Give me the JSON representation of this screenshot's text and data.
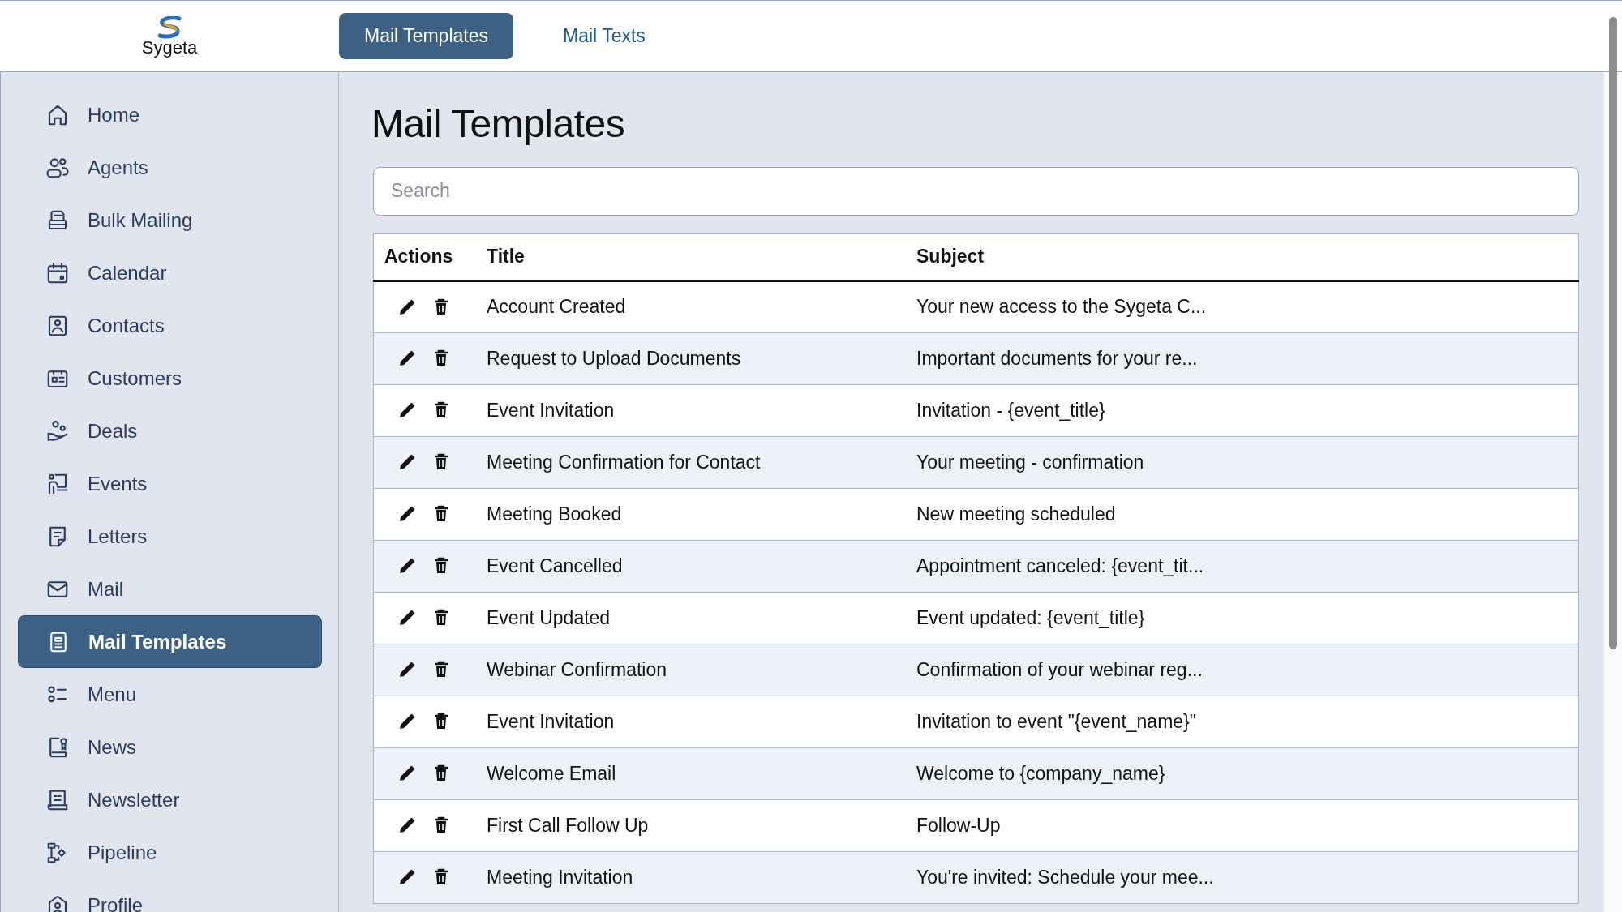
{
  "logo": {
    "text": "Sygeta"
  },
  "tabs": [
    {
      "label": "Mail Templates",
      "selected": true
    },
    {
      "label": "Mail Texts",
      "selected": false
    }
  ],
  "sidebar": {
    "items": [
      {
        "label": "Home",
        "selected": false
      },
      {
        "label": "Agents",
        "selected": false
      },
      {
        "label": "Bulk Mailing",
        "selected": false
      },
      {
        "label": "Calendar",
        "selected": false
      },
      {
        "label": "Contacts",
        "selected": false
      },
      {
        "label": "Customers",
        "selected": false
      },
      {
        "label": "Deals",
        "selected": false
      },
      {
        "label": "Events",
        "selected": false
      },
      {
        "label": "Letters",
        "selected": false
      },
      {
        "label": "Mail",
        "selected": false
      },
      {
        "label": "Mail Templates",
        "selected": true
      },
      {
        "label": "Menu",
        "selected": false
      },
      {
        "label": "News",
        "selected": false
      },
      {
        "label": "Newsletter",
        "selected": false
      },
      {
        "label": "Pipeline",
        "selected": false
      },
      {
        "label": "Profile",
        "selected": false
      }
    ]
  },
  "page_title": "Mail Templates",
  "search": {
    "placeholder": "Search"
  },
  "table": {
    "columns": [
      "Actions",
      "Title",
      "Subject"
    ],
    "rows": [
      {
        "title": "Account Created",
        "subject": "Your new access to the Sygeta C..."
      },
      {
        "title": "Request to Upload Documents",
        "subject": "Important documents for your re..."
      },
      {
        "title": "Event Invitation",
        "subject": "Invitation - {event_title}"
      },
      {
        "title": "Meeting Confirmation for Contact",
        "subject": "Your meeting - confirmation"
      },
      {
        "title": "Meeting Booked",
        "subject": "New meeting scheduled"
      },
      {
        "title": "Event Cancelled",
        "subject": "Appointment canceled: {event_tit..."
      },
      {
        "title": "Event Updated",
        "subject": "Event updated: {event_title}"
      },
      {
        "title": "Webinar Confirmation",
        "subject": "Confirmation of your webinar reg..."
      },
      {
        "title": "Event Invitation",
        "subject": "Invitation to event \"{event_name}\""
      },
      {
        "title": "Welcome Email",
        "subject": "Welcome to {company_name}"
      },
      {
        "title": "First Call Follow Up",
        "subject": "Follow-Up"
      },
      {
        "title": "Meeting Invitation",
        "subject": "You're invited: Schedule your mee..."
      }
    ]
  }
}
